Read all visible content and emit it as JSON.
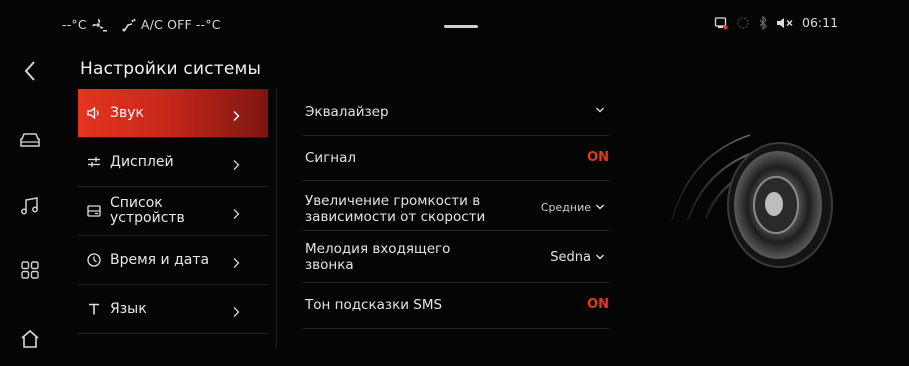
{
  "status": {
    "temp_left": "--°C",
    "ac_label": "A/C OFF",
    "temp_right": "--°C",
    "time": "06:11"
  },
  "page": {
    "title": "Настройки системы"
  },
  "menu": {
    "items": [
      {
        "label": "Звук",
        "icon": "speaker-icon",
        "active": true
      },
      {
        "label": "Дисплей",
        "icon": "sliders-icon",
        "active": false
      },
      {
        "label": "Список\nустройств",
        "icon": "device-list-icon",
        "active": false
      },
      {
        "label": "Время и дата",
        "icon": "clock-icon",
        "active": false
      },
      {
        "label": "Язык",
        "icon": "text-icon",
        "active": false
      }
    ]
  },
  "settings": {
    "rows": [
      {
        "label": "Эквалайзер",
        "value": "",
        "type": "dropdown"
      },
      {
        "label": "Сигнал",
        "value": "ON",
        "type": "toggle"
      },
      {
        "label": "Увеличение громкости в\nзависимости от скорости",
        "value": "Средние",
        "type": "dropdown"
      },
      {
        "label": "Мелодия входящего\nзвонка",
        "value": "Sedna",
        "type": "dropdown"
      },
      {
        "label": "Тон подсказки SMS",
        "value": "ON",
        "type": "toggle"
      }
    ]
  },
  "colors": {
    "accent": "#e3351e",
    "on_text": "#e4391f",
    "background": "#050505"
  },
  "icons": {
    "leftbar": [
      "back-arrow-icon",
      "car-icon",
      "music-note-icon",
      "apps-grid-icon",
      "home-icon"
    ],
    "status": [
      "fan-icon",
      "seat-heat-icon",
      "phone-projection-icon",
      "loading-icon",
      "bluetooth-icon",
      "mute-icon"
    ]
  }
}
